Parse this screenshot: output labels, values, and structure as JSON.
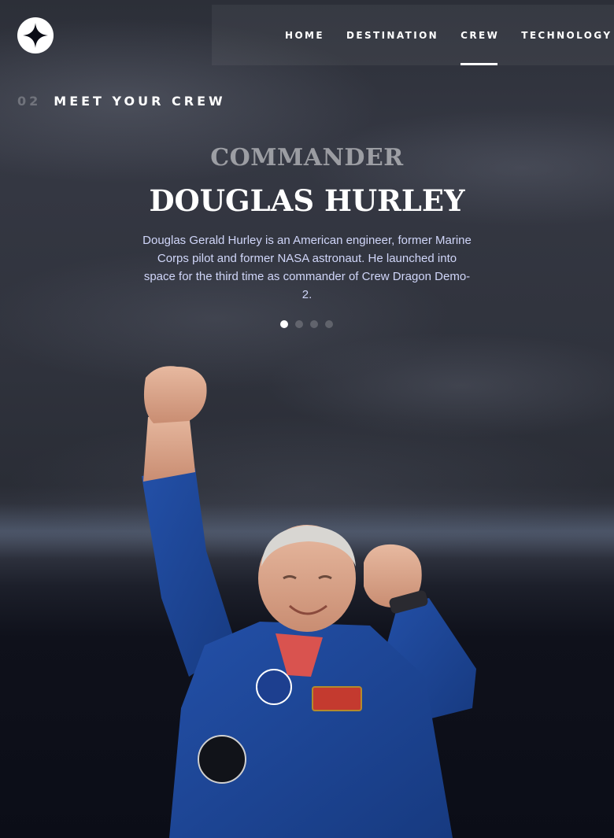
{
  "header": {
    "nav": [
      {
        "label": "HOME",
        "active": false
      },
      {
        "label": "DESTINATION",
        "active": false
      },
      {
        "label": "CREW",
        "active": true
      },
      {
        "label": "TECHNOLOGY",
        "active": false
      }
    ]
  },
  "page": {
    "number": "02",
    "title": "MEET YOUR CREW"
  },
  "crew": {
    "role": "COMMANDER",
    "name": "DOUGLAS HURLEY",
    "bio": "Douglas Gerald Hurley is an American engineer, former Marine Corps pilot and former NASA astronaut. He launched into space for the third time as commander of Crew Dragon Demo-2.",
    "active_index": 0,
    "count": 4
  },
  "icons": {
    "logo": "star-logo-icon"
  }
}
